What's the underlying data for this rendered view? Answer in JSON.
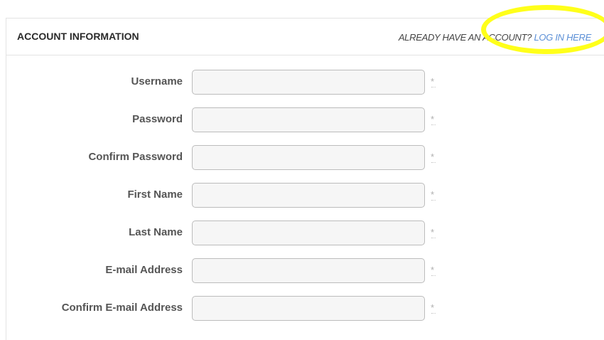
{
  "header": {
    "title": "ACCOUNT INFORMATION",
    "prompt": "ALREADY HAVE AN ACCOUNT?",
    "login_link": "LOG IN HERE"
  },
  "required_marker": "*",
  "form": {
    "fields": [
      {
        "label": "Username",
        "value": ""
      },
      {
        "label": "Password",
        "value": ""
      },
      {
        "label": "Confirm Password",
        "value": ""
      },
      {
        "label": "First Name",
        "value": ""
      },
      {
        "label": "Last Name",
        "value": ""
      },
      {
        "label": "E-mail Address",
        "value": ""
      },
      {
        "label": "Confirm E-mail Address",
        "value": ""
      }
    ]
  },
  "colors": {
    "link": "#5b8fd6",
    "highlight": "#ffff1a",
    "label": "#555555"
  }
}
